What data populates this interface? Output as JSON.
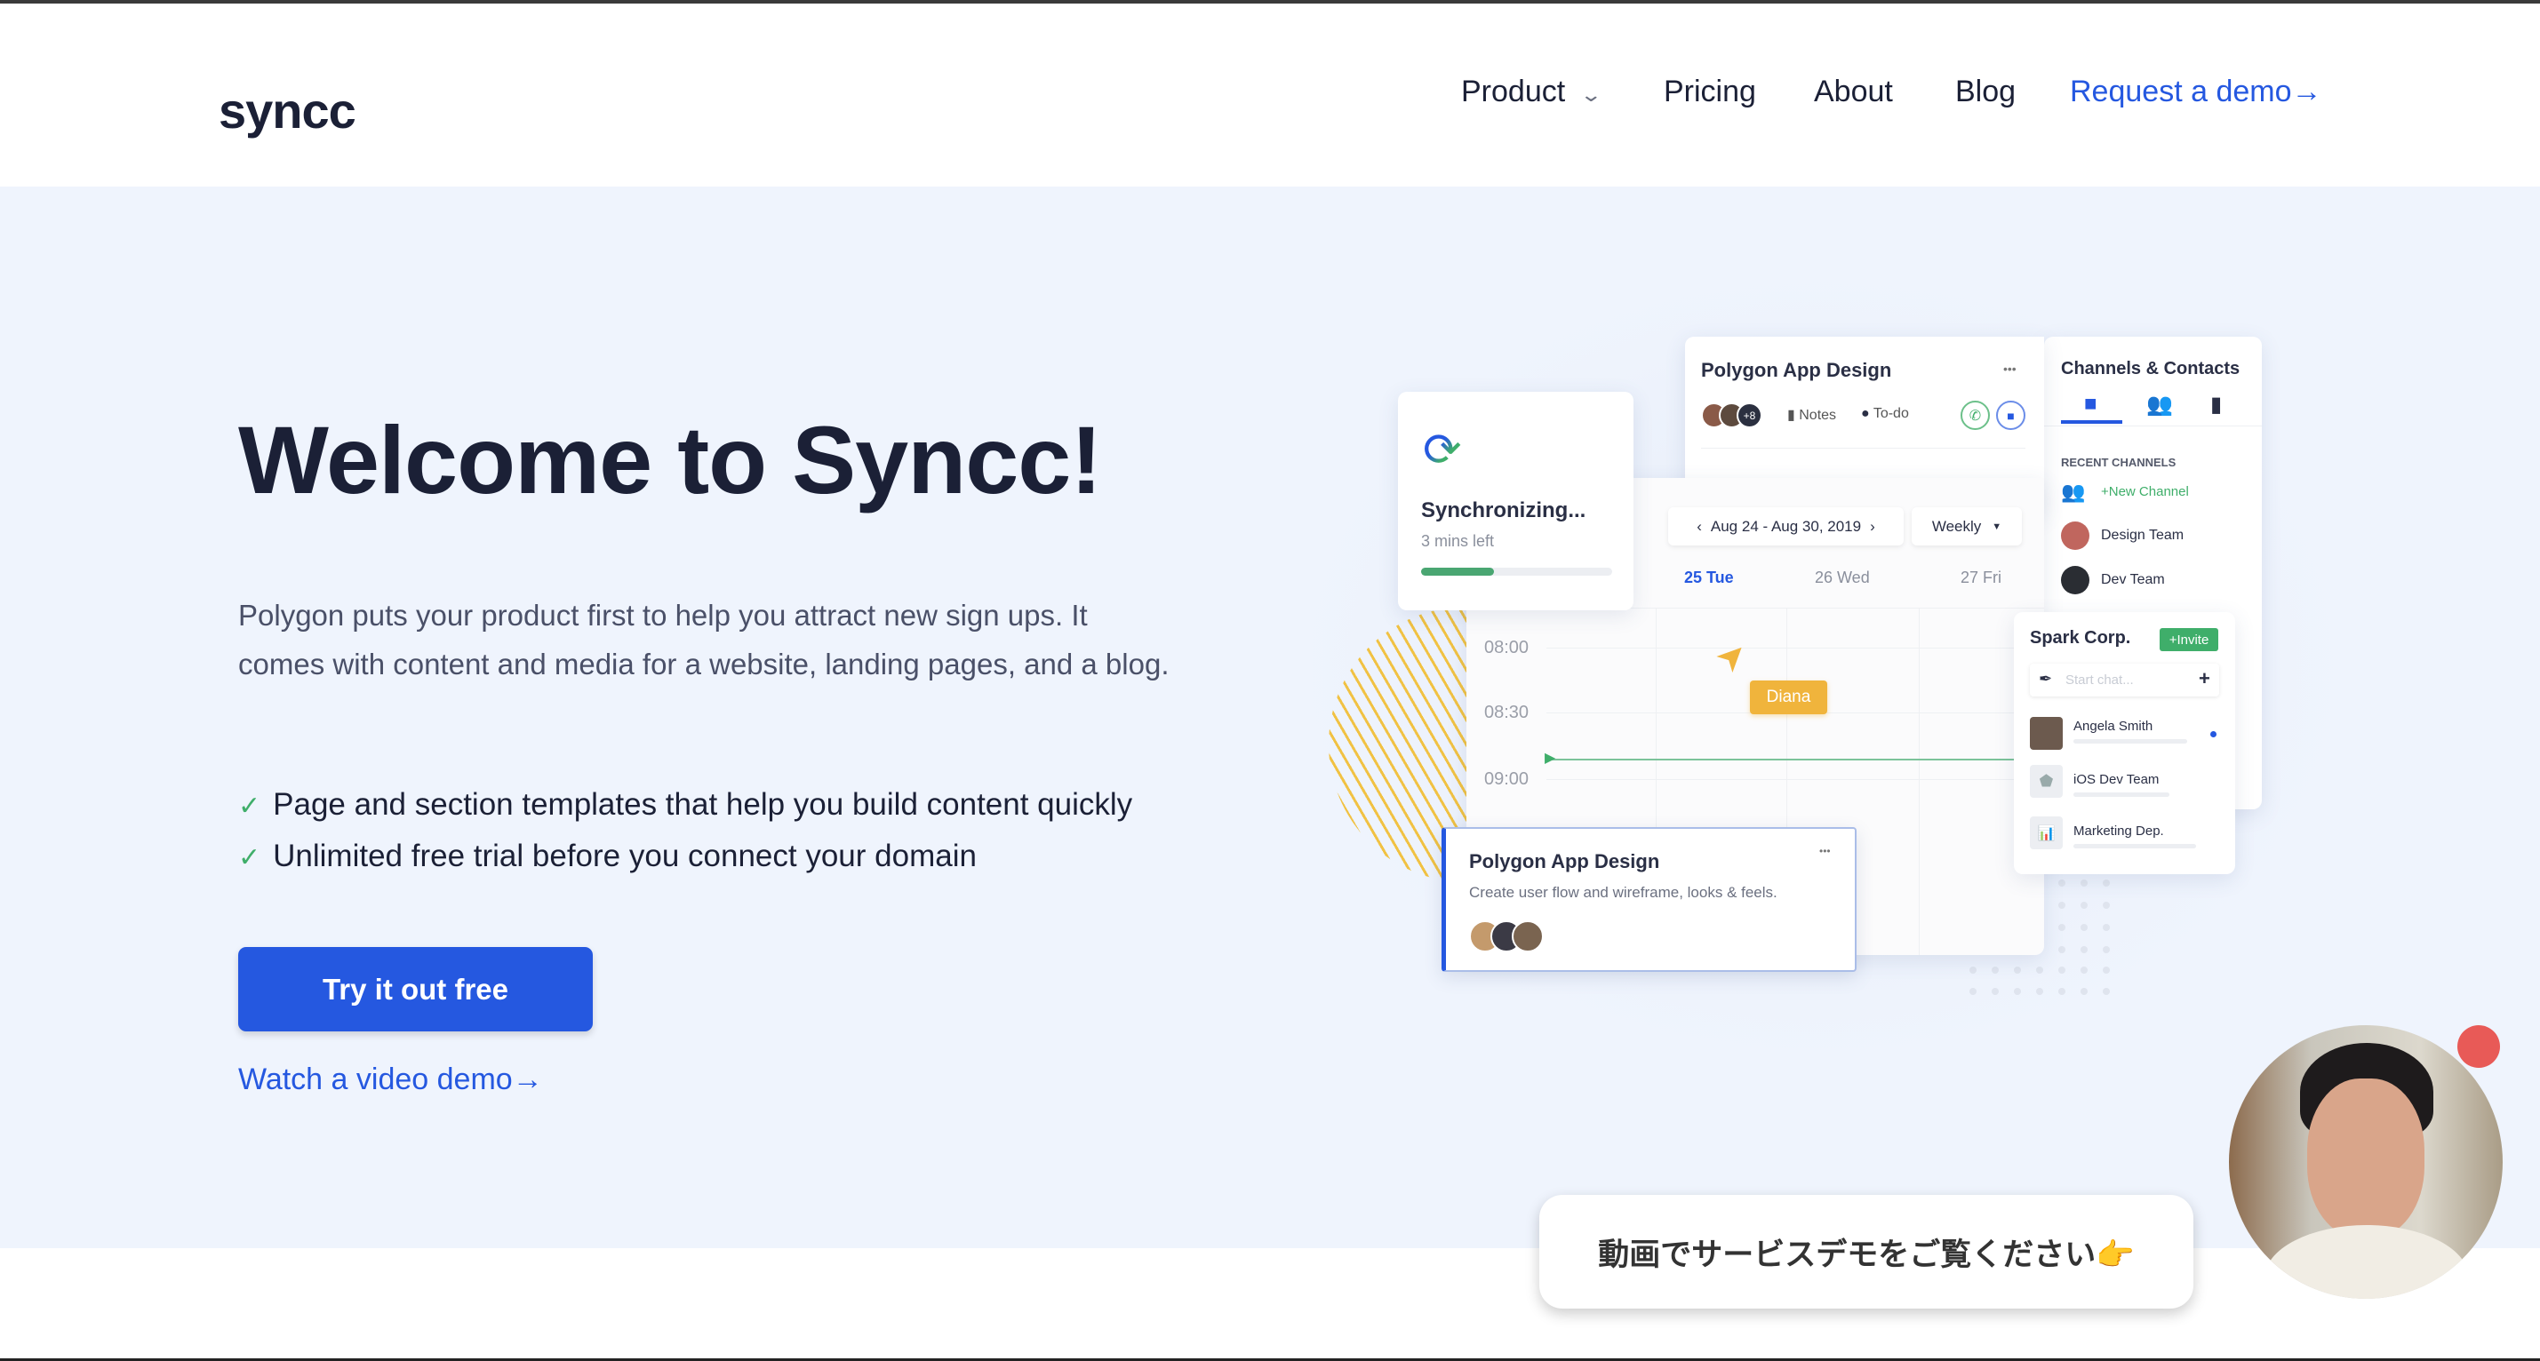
{
  "header": {
    "logo": "syncc",
    "nav": [
      {
        "label": "Product",
        "icon": "chevron-down-icon"
      },
      {
        "label": "Pricing"
      },
      {
        "label": "About"
      },
      {
        "label": "Blog"
      }
    ],
    "cta": "Request a demo",
    "cta_arrow": "→"
  },
  "hero": {
    "title": "Welcome to Syncc!",
    "description": "Polygon puts your product first to help you attract new sign ups. It comes with content and media for a website, landing pages, and a blog.",
    "features": [
      "Page and section templates that help you build content quickly",
      "Unlimited free trial before you connect your domain"
    ],
    "check_icon": "✓",
    "primary_button": "Try it out free",
    "video_link": "Watch a video demo",
    "video_link_arrow": "→"
  },
  "illustration": {
    "project_card": {
      "title": "Polygon App Design",
      "more": "•••",
      "avatar_count": "+8",
      "notes": "Notes",
      "todo": "To-do"
    },
    "channels": {
      "title": "Channels & Contacts",
      "section": "RECENT CHANNELS",
      "items": [
        "+New Channel",
        "Design Team",
        "Dev Team"
      ]
    },
    "sync": {
      "title": "Synchronizing...",
      "subtitle": "3 mins left",
      "progress": 0.38
    },
    "calendar": {
      "range": "Aug 24 - Aug 30, 2019",
      "view": "Weekly",
      "days": [
        "25 Tue",
        "26 Wed",
        "27 Fri"
      ],
      "times": [
        "08:00",
        "08:30",
        "09:00"
      ],
      "cursor_label": "Diana"
    },
    "spark": {
      "title": "Spark Corp.",
      "invite": "+Invite",
      "placeholder": "Start chat...",
      "add": "+",
      "contacts": [
        "Angela Smith",
        "iOS Dev Team",
        "Marketing Dep."
      ]
    },
    "task": {
      "title": "Polygon App Design",
      "description": "Create user flow and wireframe, looks & feels.",
      "more": "•••"
    }
  },
  "video_widget": {
    "message": "動画でサービスデモをご覧ください👉"
  },
  "colors": {
    "accent": "#2558e0",
    "text": "#1b2036",
    "hero_bg": "#eff4fd",
    "green": "#3fae6a",
    "orange": "#f0b43c",
    "record": "#e85a57"
  }
}
